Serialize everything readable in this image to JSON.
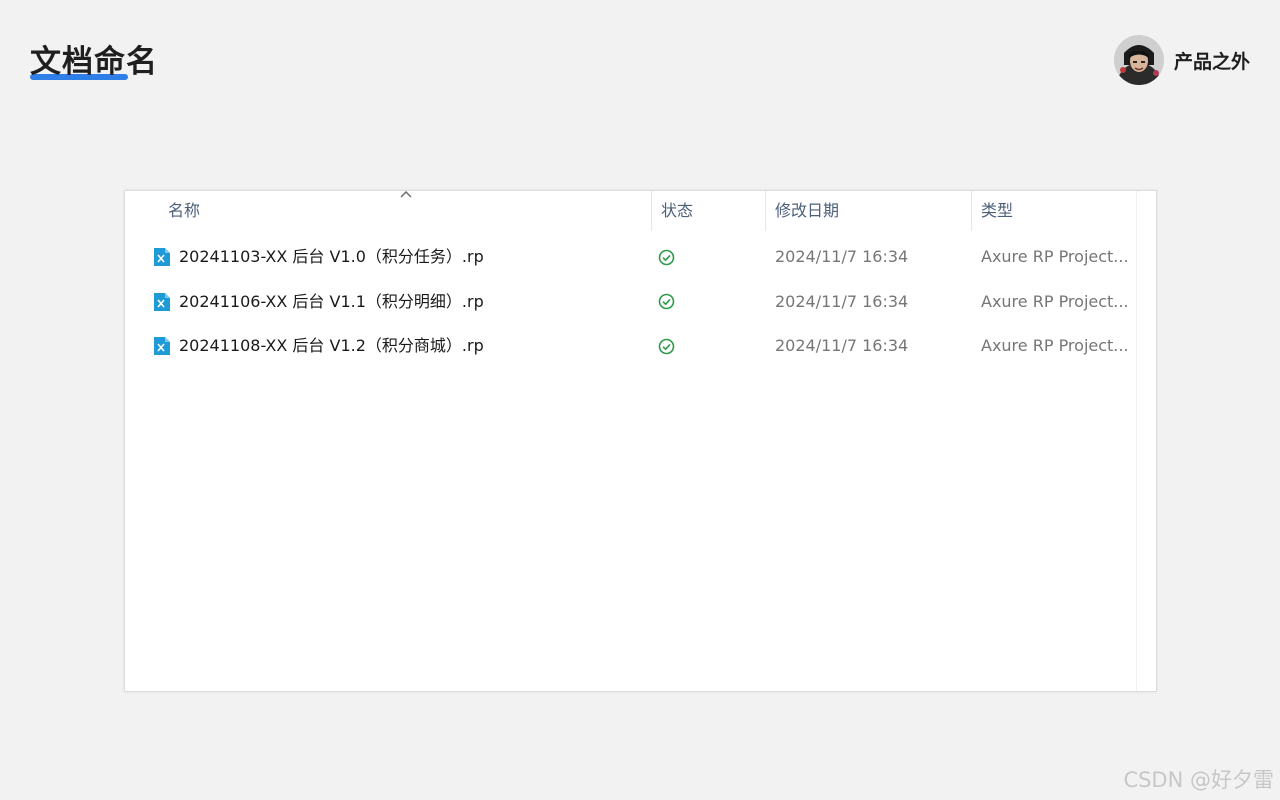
{
  "slide": {
    "title": "文档命名",
    "brand_name": "产品之外",
    "watermark": "CSDN @好夕雷"
  },
  "explorer": {
    "columns": {
      "name": "名称",
      "status": "状态",
      "modified": "修改日期",
      "type": "类型"
    },
    "sort": {
      "column": "name",
      "direction": "ascending"
    },
    "files": [
      {
        "name": "20241103-XX 后台 V1.0（积分任务）.rp",
        "status_icon": "synced-check-icon",
        "modified": "2024/11/7 16:34",
        "type": "Axure RP Project..."
      },
      {
        "name": "20241106-XX 后台 V1.1（积分明细）.rp",
        "status_icon": "synced-check-icon",
        "modified": "2024/11/7 16:34",
        "type": "Axure RP Project..."
      },
      {
        "name": "20241108-XX 后台 V1.2（积分商城）.rp",
        "status_icon": "synced-check-icon",
        "modified": "2024/11/7 16:34",
        "type": "Axure RP Project..."
      }
    ]
  },
  "colors": {
    "accent_underline": "#2f7fe8",
    "status_ok": "#2e9a4a",
    "axure_icon": "#1e9ad6"
  }
}
